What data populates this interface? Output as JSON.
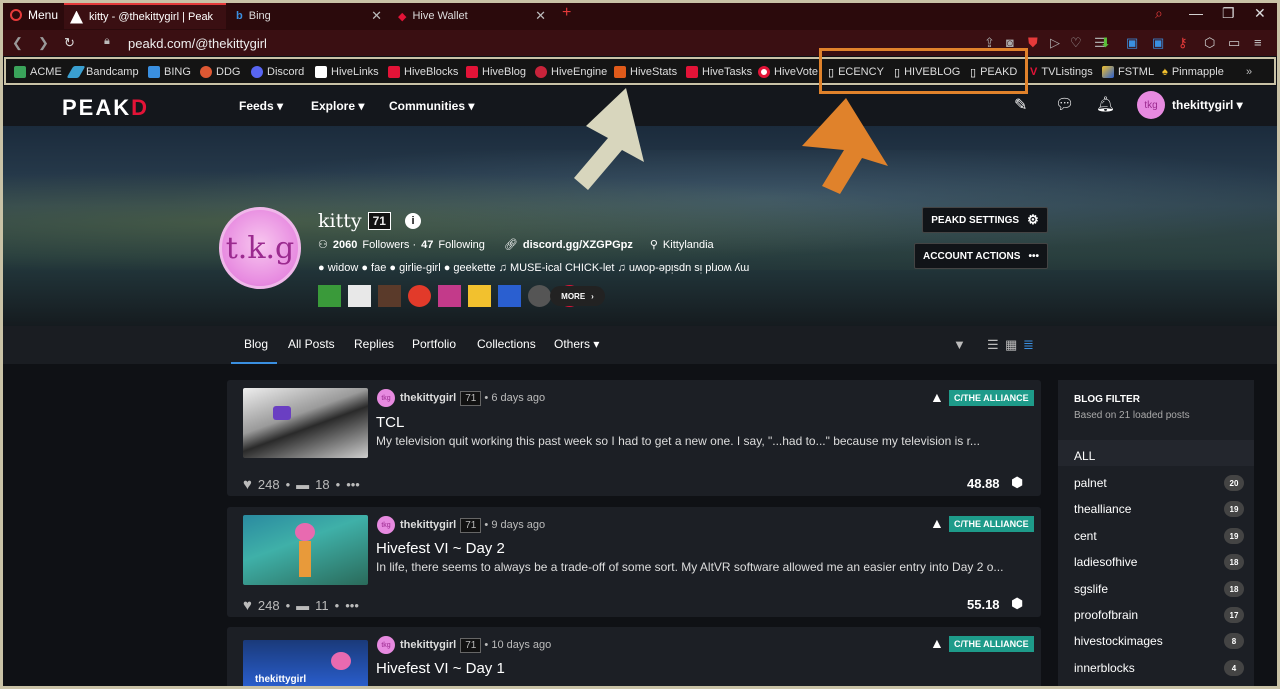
{
  "browser": {
    "menu_label": "Menu",
    "tabs": [
      {
        "label": "kitty - @thekittygirl | Peak"
      },
      {
        "label": "Bing"
      },
      {
        "label": "Hive Wallet"
      }
    ],
    "url": "peakd.com/@thekittygirl"
  },
  "bookmarks": [
    "ACME",
    "Bandcamp",
    "BING",
    "DDG",
    "Discord",
    "HiveLinks",
    "HiveBlocks",
    "HiveBlog",
    "HiveEngine",
    "HiveStats",
    "HiveTasks",
    "HiveVote",
    "ECENCY",
    "HIVEBLOG",
    "PEAKD",
    "TVListings",
    "FSTML",
    "Pinmapple"
  ],
  "site": {
    "logo_a": "PEAK",
    "logo_b": "D",
    "nav": [
      "Feeds",
      "Explore",
      "Communities"
    ],
    "username": "thekittygirl"
  },
  "profile": {
    "avatar_text": "t.k.g",
    "name": "kitty",
    "rep": "71",
    "followers": "2060",
    "followers_label": "Followers ·",
    "following": "47",
    "following_label": "Following",
    "discord": "discord.gg/XZGPGpz",
    "location": "Kittylandia",
    "bio": "● widow ● fae ● girlie-girl ● geekette ♫ MUSE-ical CHICK-let ♫ uʍop-ǝpᴉsdn sᴉ plɹoʍ ʎɯ",
    "more_label": "MORE",
    "settings_label": "PEAKD SETTINGS",
    "actions_label": "ACCOUNT ACTIONS"
  },
  "profile_tabs": [
    "Blog",
    "All Posts",
    "Replies",
    "Portfolio",
    "Collections",
    "Others"
  ],
  "posts": [
    {
      "author": "thekittygirl",
      "rep": "71",
      "time": "6 days ago",
      "community": "C/THE ALLIANCE",
      "title": "TCL",
      "excerpt": "My television quit working this past week so I had to get a new one. I say, \"...had to...\" because my television is r...",
      "likes": "248",
      "comments": "18",
      "payout": "48.88"
    },
    {
      "author": "thekittygirl",
      "rep": "71",
      "time": "9 days ago",
      "community": "C/THE ALLIANCE",
      "title": "Hivefest VI ~ Day 2",
      "excerpt": "In life, there seems to always be a trade-off of some sort. My AltVR software allowed me an easier entry into Day 2 o...",
      "likes": "248",
      "comments": "11",
      "payout": "55.18"
    },
    {
      "author": "thekittygirl",
      "rep": "71",
      "time": "10 days ago",
      "community": "C/THE ALLIANCE",
      "title": "Hivefest VI ~ Day 1",
      "thumb_text": "thekittygirl"
    }
  ],
  "blog_filter": {
    "title": "BLOG FILTER",
    "subtitle": "Based on 21 loaded posts",
    "all_label": "ALL",
    "items": [
      {
        "name": "palnet",
        "count": "20"
      },
      {
        "name": "thealliance",
        "count": "19"
      },
      {
        "name": "cent",
        "count": "19"
      },
      {
        "name": "ladiesofhive",
        "count": "18"
      },
      {
        "name": "sgslife",
        "count": "18"
      },
      {
        "name": "proofofbrain",
        "count": "17"
      },
      {
        "name": "hivestockimages",
        "count": "8"
      },
      {
        "name": "innerblocks",
        "count": "4"
      }
    ]
  },
  "colors": {
    "accent": "#e31337",
    "annotation_orange": "#e0822b",
    "annotation_cream": "#d8d6bd",
    "community": "#1e9b8a"
  }
}
